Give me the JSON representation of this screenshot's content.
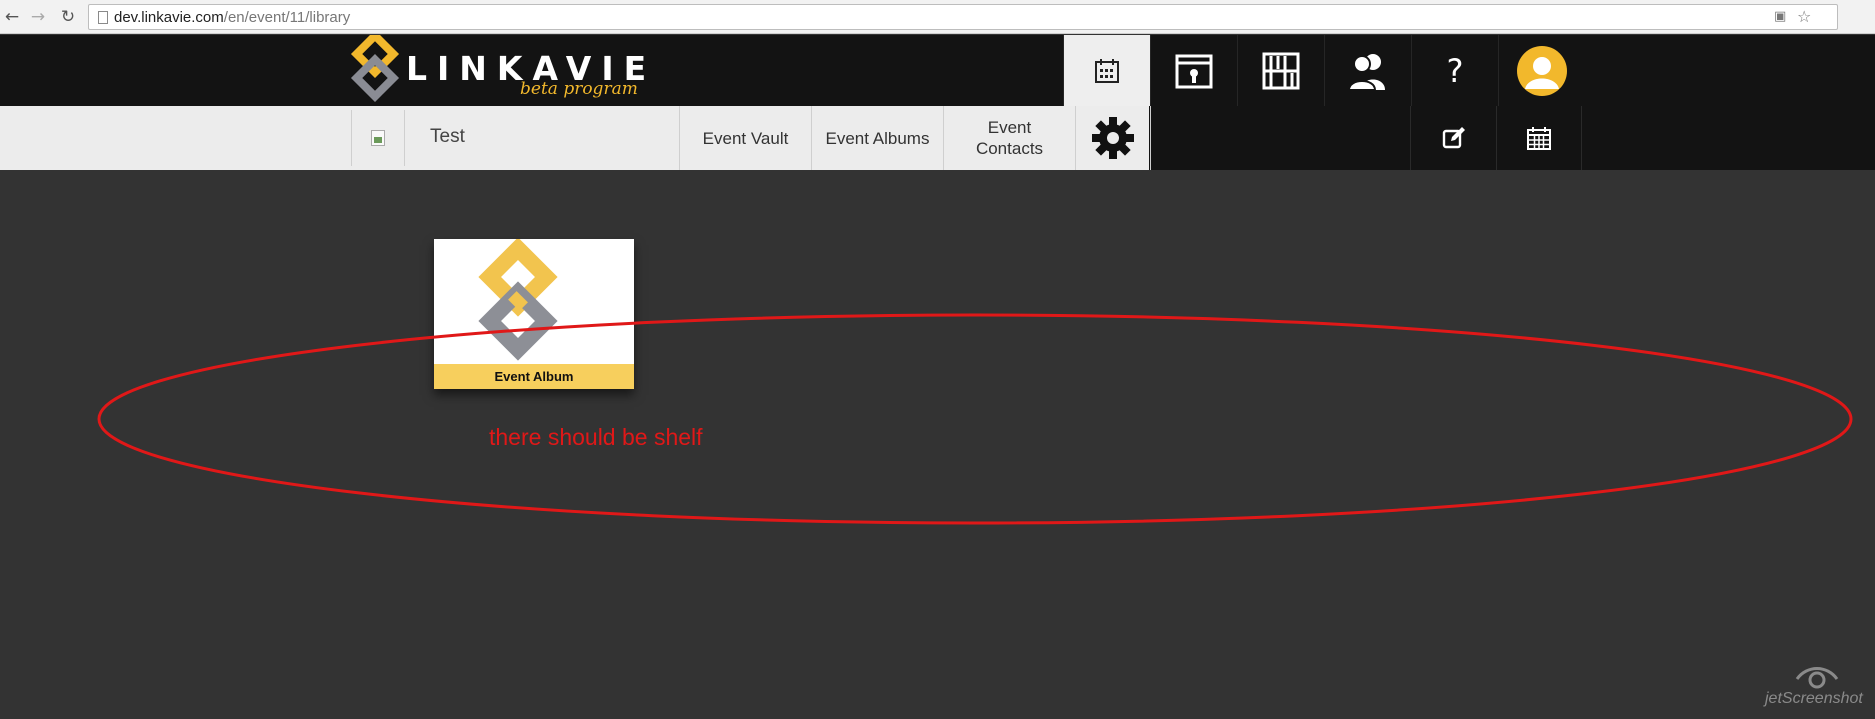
{
  "browser": {
    "url_host": "dev.linkavie.com",
    "url_path": "/en/event/11/library",
    "back_icon": "arrow-left-icon",
    "forward_icon": "arrow-right-icon",
    "reload_icon": "reload-icon",
    "star_icon": "star-icon"
  },
  "header": {
    "logo_text": "LINKAVIE",
    "logo_subtitle": "beta program",
    "nav": [
      {
        "icon": "calendar-icon",
        "active": true
      },
      {
        "icon": "vault-icon"
      },
      {
        "icon": "library-icon"
      },
      {
        "icon": "contacts-icon"
      },
      {
        "label": "?"
      },
      {
        "icon": "avatar-icon"
      }
    ]
  },
  "event": {
    "name": "Test",
    "tabs": [
      "Event Vault",
      "Event Albums",
      "Event Contacts"
    ],
    "settings_icon": "gear-icon",
    "actions": [
      "edit-icon",
      "calendar-icon"
    ]
  },
  "library": {
    "albums": [
      {
        "label": "Event Album"
      }
    ]
  },
  "annotation": {
    "text": "there should be shelf",
    "color": "#e01818"
  },
  "watermark": {
    "text": "jetScreenshot"
  },
  "colors": {
    "brand_yellow": "#f2b82c",
    "topbar": "#131313",
    "background": "#333333",
    "subbar": "#ececec"
  }
}
